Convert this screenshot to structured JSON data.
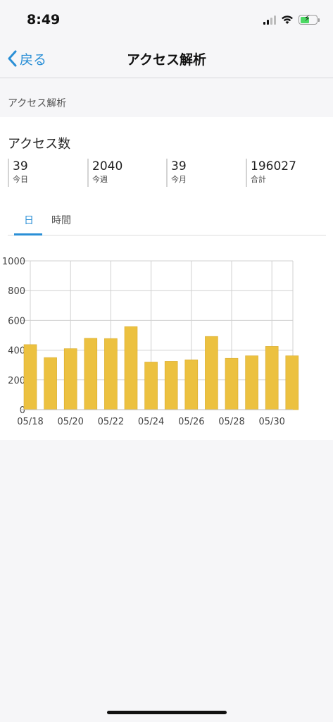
{
  "status_bar": {
    "time": "8:49"
  },
  "nav": {
    "back_label": "戻る",
    "title": "アクセス解析"
  },
  "section": {
    "header": "アクセス解析"
  },
  "card": {
    "title": "アクセス数",
    "stats": [
      {
        "value": "39",
        "label": "今日"
      },
      {
        "value": "2040",
        "label": "今週"
      },
      {
        "value": "39",
        "label": "今月"
      },
      {
        "value": "196027",
        "label": "合計"
      }
    ],
    "tabs": [
      {
        "label": "日",
        "active": true
      },
      {
        "label": "時間",
        "active": false
      }
    ]
  },
  "colors": {
    "accent": "#2a8fd6",
    "bar": "#ecc140",
    "bar_border": "#d8ac2e"
  },
  "chart_data": {
    "type": "bar",
    "x": [
      "05/18",
      "05/19",
      "05/20",
      "05/21",
      "05/22",
      "05/23",
      "05/24",
      "05/25",
      "05/26",
      "05/27",
      "05/28",
      "05/29",
      "05/30",
      "05/31"
    ],
    "values": [
      437,
      350,
      410,
      480,
      478,
      558,
      320,
      325,
      335,
      492,
      345,
      362,
      425,
      362
    ],
    "x_tick_labels": [
      "05/18",
      "05/20",
      "05/22",
      "05/24",
      "05/26",
      "05/28",
      "05/30"
    ],
    "y_ticks": [
      0,
      200,
      400,
      600,
      800,
      1000
    ],
    "ylim": [
      0,
      1000
    ],
    "grid": true
  }
}
